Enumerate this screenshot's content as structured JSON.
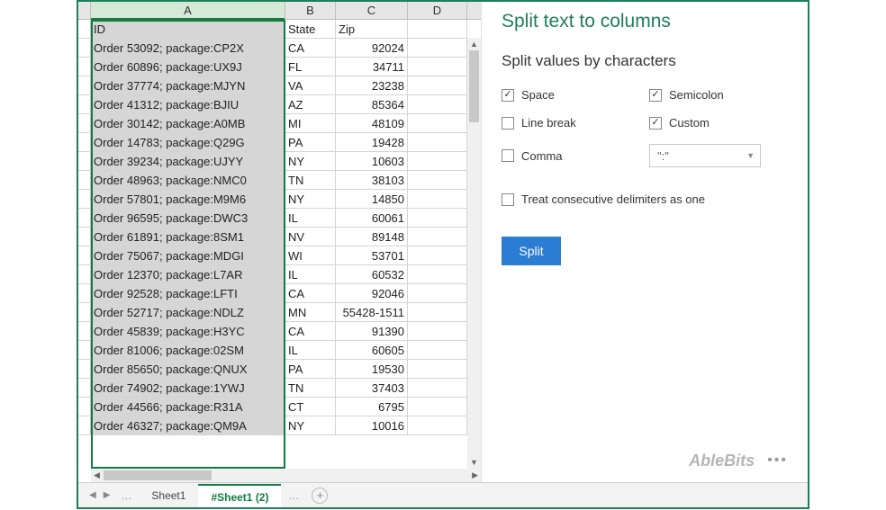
{
  "columns": [
    "A",
    "B",
    "C",
    "D"
  ],
  "headers": {
    "id": "ID",
    "state": "State",
    "zip": "Zip"
  },
  "rows": [
    {
      "id": "Order 53092; package:CP2X",
      "state": "CA",
      "zip": "92024"
    },
    {
      "id": "Order 60896; package:UX9J",
      "state": "FL",
      "zip": "34711"
    },
    {
      "id": "Order 37774; package:MJYN",
      "state": "VA",
      "zip": "23238"
    },
    {
      "id": "Order 41312; package:BJIU",
      "state": "AZ",
      "zip": "85364"
    },
    {
      "id": "Order 30142; package:A0MB",
      "state": "MI",
      "zip": "48109"
    },
    {
      "id": "Order 14783; package:Q29G",
      "state": "PA",
      "zip": "19428"
    },
    {
      "id": "Order 39234; package:UJYY",
      "state": "NY",
      "zip": "10603"
    },
    {
      "id": "Order 48963; package:NMC0",
      "state": "TN",
      "zip": "38103"
    },
    {
      "id": "Order 57801; package:M9M6",
      "state": "NY",
      "zip": "14850"
    },
    {
      "id": "Order 96595; package:DWC3",
      "state": "IL",
      "zip": "60061"
    },
    {
      "id": "Order 61891; package:8SM1",
      "state": "NV",
      "zip": "89148"
    },
    {
      "id": "Order 75067; package:MDGI",
      "state": "WI",
      "zip": "53701"
    },
    {
      "id": "Order 12370; package:L7AR",
      "state": "IL",
      "zip": "60532"
    },
    {
      "id": "Order 92528; package:LFTI",
      "state": "CA",
      "zip": "92046"
    },
    {
      "id": "Order 52717; package:NDLZ",
      "state": "MN",
      "zip": "55428-1511"
    },
    {
      "id": "Order 45839; package:H3YC",
      "state": "CA",
      "zip": "91390"
    },
    {
      "id": "Order 81006; package:02SM",
      "state": "IL",
      "zip": "60605"
    },
    {
      "id": "Order 85650; package:QNUX",
      "state": "PA",
      "zip": "19530"
    },
    {
      "id": "Order 74902; package:1YWJ",
      "state": "TN",
      "zip": "37403"
    },
    {
      "id": "Order 44566; package:R31A",
      "state": "CT",
      "zip": "6795"
    },
    {
      "id": "Order 46327; package:QM9A",
      "state": "NY",
      "zip": "10016"
    }
  ],
  "tabs": {
    "sheet1": "Sheet1",
    "sheet1copy": "#Sheet1 (2)"
  },
  "panel": {
    "title": "Split text to columns",
    "subtitle": "Split values by characters",
    "opts": {
      "space": "Space",
      "semicolon": "Semicolon",
      "linebreak": "Line break",
      "custom": "Custom",
      "comma": "Comma",
      "custom_value": "\":\""
    },
    "treat": "Treat consecutive delimiters as one",
    "split": "Split"
  },
  "brand": "AbleBits"
}
